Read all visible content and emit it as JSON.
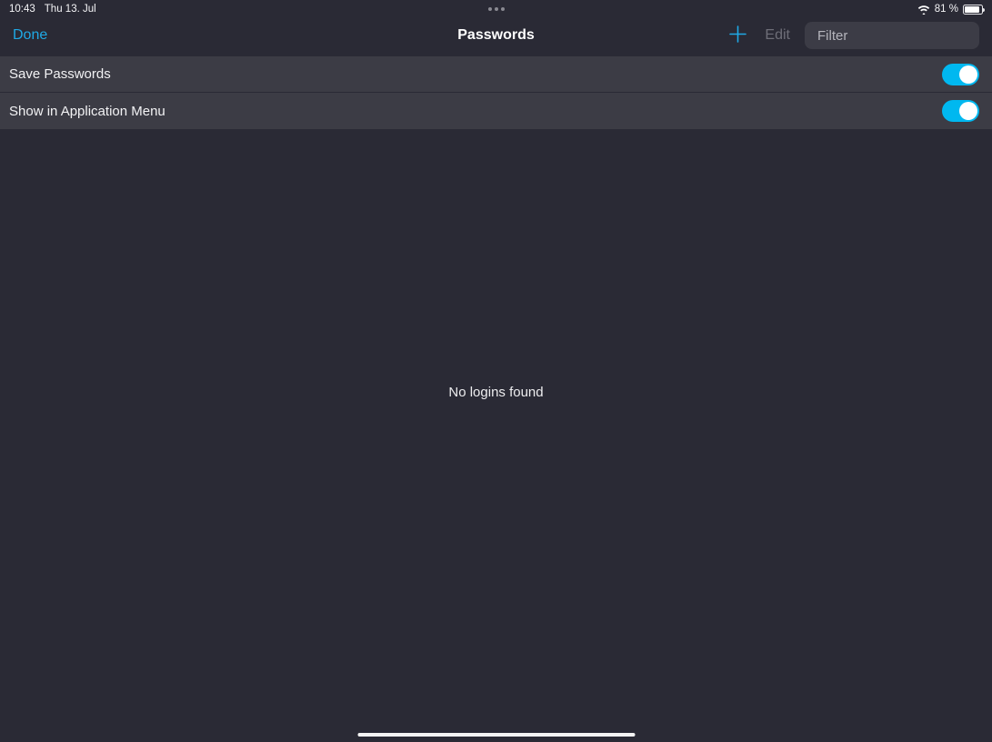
{
  "status": {
    "time": "10:43",
    "date": "Thu 13. Jul",
    "battery_percent": "81 %"
  },
  "nav": {
    "done": "Done",
    "title": "Passwords",
    "edit": "Edit",
    "search_placeholder": "Filter"
  },
  "settings": [
    {
      "label": "Save Passwords",
      "on": true
    },
    {
      "label": "Show in Application Menu",
      "on": true
    }
  ],
  "empty_message": "No logins found"
}
